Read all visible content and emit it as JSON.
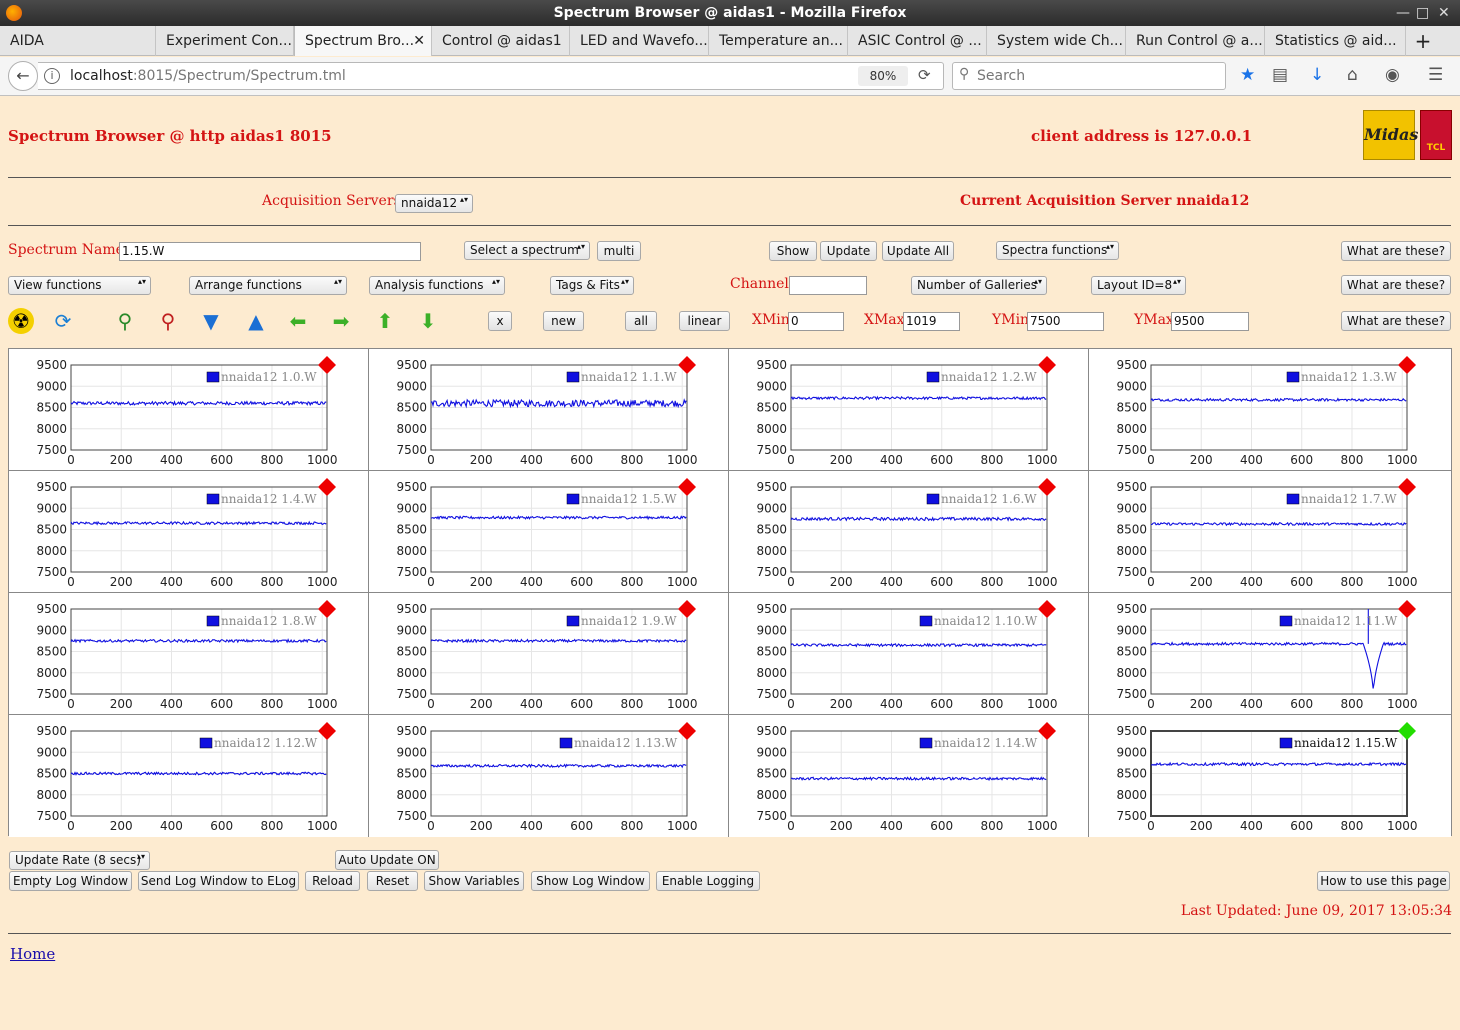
{
  "window": {
    "title": "Spectrum Browser @ aidas1 - Mozilla Firefox"
  },
  "tabs": [
    {
      "label": "AIDA",
      "active": false
    },
    {
      "label": "Experiment Con...",
      "active": false
    },
    {
      "label": "Spectrum Bro...",
      "active": true
    },
    {
      "label": "Control @ aidas1",
      "active": false
    },
    {
      "label": "LED and Wavefo...",
      "active": false
    },
    {
      "label": "Temperature an...",
      "active": false
    },
    {
      "label": "ASIC Control @ ...",
      "active": false
    },
    {
      "label": "System wide Ch...",
      "active": false
    },
    {
      "label": "Run Control @ a...",
      "active": false
    },
    {
      "label": "Statistics @ aid...",
      "active": false
    }
  ],
  "navbar": {
    "url_host": "localhost",
    "url_rest": ":8015/Spectrum/Spectrum.tml",
    "zoom": "80%",
    "search_placeholder": "Search"
  },
  "header": {
    "title": "Spectrum Browser @ http aidas1 8015",
    "client": "client address is 127.0.0.1"
  },
  "acq": {
    "label": "Acquisition Servers",
    "selected": "nnaida12",
    "current": "Current Acquisition Server nnaida12"
  },
  "row1": {
    "spectrum_label": "Spectrum Name:",
    "spectrum_value": "1.15.W",
    "select_spectrum": "Select a spectrum",
    "multi": "multi",
    "show": "Show",
    "update": "Update",
    "update_all": "Update All",
    "spectra_functions": "Spectra functions",
    "what": "What are these?"
  },
  "row2": {
    "view_functions": "View functions",
    "arrange_functions": "Arrange functions",
    "analysis_functions": "Analysis functions",
    "tags_fits": "Tags & Fits",
    "channel_label": "Channel:",
    "channel_value": "",
    "galleries": "Number of Galleries",
    "layout": "Layout ID=8",
    "what": "What are these?"
  },
  "row3": {
    "x": "x",
    "new": "new",
    "all": "all",
    "linear": "linear",
    "xmin_label": "XMin",
    "xmin": "0",
    "xmax_label": "XMax",
    "xmax": "1019",
    "ymin_label": "YMin",
    "ymin": "7500",
    "ymax_label": "YMax",
    "ymax": "9500",
    "what": "What are these?"
  },
  "chart_data": {
    "type": "line",
    "xlim": [
      0,
      1019
    ],
    "ylim": [
      7500,
      9500
    ],
    "x_ticks": [
      0,
      200,
      400,
      600,
      800,
      1000
    ],
    "y_ticks": [
      9500,
      9000,
      8500,
      8000,
      7500
    ],
    "series": [
      {
        "name": "nnaida12 1.0.W",
        "baseline": 8600,
        "noise": 40,
        "status": "red"
      },
      {
        "name": "nnaida12 1.1.W",
        "baseline": 8600,
        "noise": 80,
        "status": "red"
      },
      {
        "name": "nnaida12 1.2.W",
        "baseline": 8720,
        "noise": 30,
        "status": "red"
      },
      {
        "name": "nnaida12 1.3.W",
        "baseline": 8680,
        "noise": 30,
        "status": "red"
      },
      {
        "name": "nnaida12 1.4.W",
        "baseline": 8650,
        "noise": 30,
        "status": "red"
      },
      {
        "name": "nnaida12 1.5.W",
        "baseline": 8780,
        "noise": 30,
        "status": "red"
      },
      {
        "name": "nnaida12 1.6.W",
        "baseline": 8750,
        "noise": 35,
        "status": "red"
      },
      {
        "name": "nnaida12 1.7.W",
        "baseline": 8630,
        "noise": 30,
        "status": "red"
      },
      {
        "name": "nnaida12 1.8.W",
        "baseline": 8750,
        "noise": 30,
        "status": "red"
      },
      {
        "name": "nnaida12 1.9.W",
        "baseline": 8750,
        "noise": 30,
        "status": "red"
      },
      {
        "name": "nnaida12 1.10.W",
        "baseline": 8650,
        "noise": 30,
        "status": "red"
      },
      {
        "name": "nnaida12 1.11.W",
        "baseline": 8680,
        "noise": 30,
        "status": "red",
        "dip_center": 885,
        "dip_min": 7500
      },
      {
        "name": "nnaida12 1.12.W",
        "baseline": 8500,
        "noise": 30,
        "status": "red"
      },
      {
        "name": "nnaida12 1.13.W",
        "baseline": 8680,
        "noise": 30,
        "status": "red"
      },
      {
        "name": "nnaida12 1.14.W",
        "baseline": 8380,
        "noise": 30,
        "status": "red"
      },
      {
        "name": "nnaida12 1.15.W",
        "baseline": 8720,
        "noise": 30,
        "status": "green",
        "selected": true
      }
    ],
    "colors": {
      "line": "#1010e0",
      "red": "#ee0000",
      "green": "#22dd00"
    }
  },
  "bottom": {
    "update_rate": "Update Rate (8 secs)",
    "auto_update": "Auto Update ON",
    "empty_log": "Empty Log Window",
    "send_log": "Send Log Window to ELog",
    "reload": "Reload",
    "reset": "Reset",
    "show_variables": "Show Variables",
    "show_log": "Show Log Window",
    "enable_logging": "Enable Logging",
    "how_to": "How to use this page",
    "last_updated": "Last Updated: June 09, 2017 13:05:34",
    "home": "Home"
  },
  "logos": {
    "midas": "Midas",
    "tcl": "TCL"
  }
}
